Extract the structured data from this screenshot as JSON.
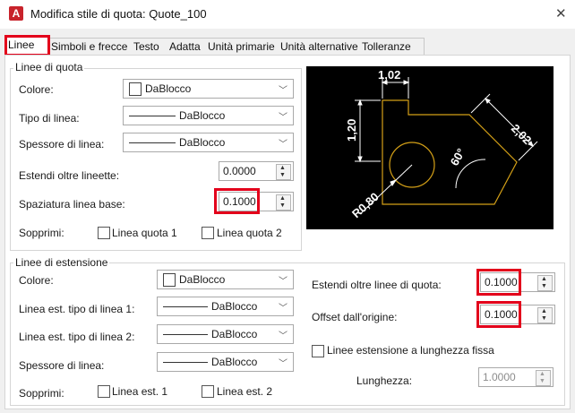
{
  "window": {
    "title": "Modifica stile di quota: Quote_100",
    "app_icon": "A"
  },
  "tabs": [
    {
      "label": "Linee",
      "active": true
    },
    {
      "label": "Simboli e frecce"
    },
    {
      "label": "Testo"
    },
    {
      "label": "Adatta"
    },
    {
      "label": "Unità primarie"
    },
    {
      "label": "Unità alternative"
    },
    {
      "label": "Tolleranze"
    }
  ],
  "dim_lines": {
    "group_label": "Linee di quota",
    "color_label": "Colore:",
    "color_value": "DaBlocco",
    "linetype_label": "Tipo di linea:",
    "linetype_value": "DaBlocco",
    "lineweight_label": "Spessore di linea:",
    "lineweight_value": "DaBlocco",
    "extend_ticks_label": "Estendi oltre lineette:",
    "extend_ticks_value": "0.0000",
    "baseline_spacing_label": "Spaziatura linea base:",
    "baseline_spacing_value": "0.1000",
    "suppress_label": "Sopprimi:",
    "suppress_1": "Linea quota 1",
    "suppress_2": "Linea quota 2"
  },
  "ext_lines": {
    "group_label": "Linee di estensione",
    "color_label": "Colore:",
    "color_value": "DaBlocco",
    "linetype1_label": "Linea est. tipo di linea 1:",
    "linetype1_value": "DaBlocco",
    "linetype2_label": "Linea est. tipo di linea 2:",
    "linetype2_value": "DaBlocco",
    "lineweight_label": "Spessore di linea:",
    "lineweight_value": "DaBlocco",
    "suppress_label": "Sopprimi:",
    "suppress_1": "Linea est. 1",
    "suppress_2": "Linea est. 2",
    "extend_beyond_label": "Estendi oltre linee di quota:",
    "extend_beyond_value": "0.1000",
    "offset_label": "Offset dall'origine:",
    "offset_value": "0.1000",
    "fixed_length_label": "Linee estensione a lunghezza fissa",
    "length_label": "Lunghezza:",
    "length_value": "1.0000"
  },
  "preview": {
    "dim_top": "1,02",
    "dim_left": "1,20",
    "dim_diag": "2,02",
    "dim_angle": "60°",
    "dim_radius": "R0,80"
  },
  "colors": {
    "highlight": "#e3001b",
    "preview_bg": "#000000",
    "preview_line": "#ffffff",
    "preview_shape": "#d4a017"
  }
}
